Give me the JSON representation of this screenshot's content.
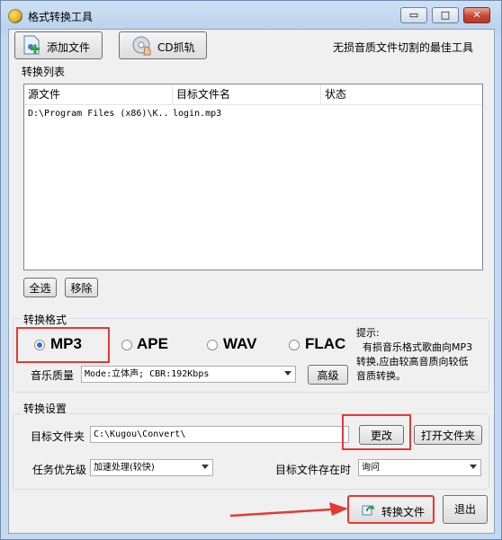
{
  "window": {
    "title": "格式转换工具",
    "min_label": "▭",
    "max_label": "□",
    "close_label": "✕"
  },
  "toolbar": {
    "add_file_label": "添加文件",
    "cd_rip_label": "CD抓轨",
    "slogan": "无损音质文件切割的最佳工具"
  },
  "convert_list": {
    "label": "转换列表",
    "columns": [
      "源文件",
      "目标文件名",
      "状态"
    ],
    "rows": [
      {
        "source": "D:\\Program Files (x86)\\K..",
        "target": "login.mp3",
        "status": ""
      }
    ],
    "select_all_label": "全选",
    "remove_label": "移除"
  },
  "format": {
    "label": "转换格式",
    "options": [
      "MP3",
      "APE",
      "WAV",
      "FLAC"
    ],
    "selected": "MP3",
    "quality_label": "音乐质量",
    "quality_value": "Mode:立体声; CBR:192Kbps",
    "advanced_label": "高级",
    "tip_title": "提示:",
    "tip_lines": [
      "  有损音乐格式歌曲向MP3",
      "转换,应由较高音质向较低",
      "音质转换。"
    ]
  },
  "settings": {
    "label": "转换设置",
    "target_folder_label": "目标文件夹",
    "target_folder_value": "C:\\Kugou\\Convert\\",
    "change_label": "更改",
    "open_folder_label": "打开文件夹",
    "priority_label": "任务优先级",
    "priority_value": "加速处理(较快)",
    "exists_label": "目标文件存在时",
    "exists_value": "询问"
  },
  "actions": {
    "convert_label": "转换文件",
    "exit_label": "退出"
  },
  "colors": {
    "highlight": "#e53935",
    "accent": "#2b6fd6"
  }
}
